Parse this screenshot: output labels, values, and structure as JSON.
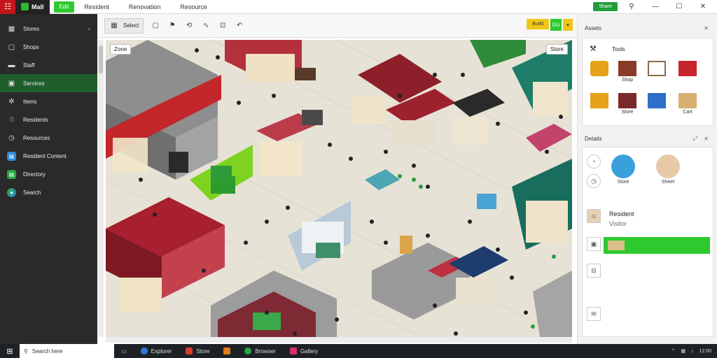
{
  "topbar": {
    "app_label": "Mall",
    "active_tab": "Edit",
    "tabs": [
      "Resident",
      "Renovation",
      "Resource"
    ],
    "green_button": "Share"
  },
  "sidebar": {
    "items": [
      {
        "label": "Stores",
        "icon": "grid-icon"
      },
      {
        "label": "Shops",
        "icon": "square-icon"
      },
      {
        "label": "Staff",
        "icon": "list-icon"
      },
      {
        "label": "Services",
        "icon": "panel-icon"
      },
      {
        "label": "Items",
        "icon": "tag-icon"
      },
      {
        "label": "Residents",
        "icon": "person-icon"
      },
      {
        "label": "Resources",
        "icon": "clock-icon"
      },
      {
        "label": "Resident Content",
        "icon": "app-blue-icon"
      },
      {
        "label": "Directory",
        "icon": "app-green-icon"
      },
      {
        "label": "Search",
        "icon": "globe-icon"
      }
    ]
  },
  "toolbar": {
    "select_label": "Select",
    "yellow_btn": "Build",
    "green_btn": "Go"
  },
  "canvas": {
    "badge_left": "Zone",
    "badge_right": "Store"
  },
  "rpanel": {
    "assets_title": "Assets",
    "assets_sub": "Tools",
    "assets": [
      "",
      "Shop",
      "",
      "",
      "",
      "Store",
      "",
      "Cart"
    ],
    "props_title": "Details",
    "props": [
      {
        "label": "Store"
      },
      {
        "label": "Sheet"
      }
    ],
    "person_name": "Resident",
    "person_sub": "Visitor"
  },
  "taskbar": {
    "search": "Search here",
    "items": [
      {
        "label": "Explorer",
        "color": "#2e7ad8"
      },
      {
        "label": "Store",
        "color": "#d83b2e"
      },
      {
        "label": "",
        "color": "#e07b1a"
      },
      {
        "label": "Browser",
        "color": "#27a845"
      },
      {
        "label": "Gallery",
        "color": "#d8306d"
      }
    ],
    "time": "12:00"
  }
}
